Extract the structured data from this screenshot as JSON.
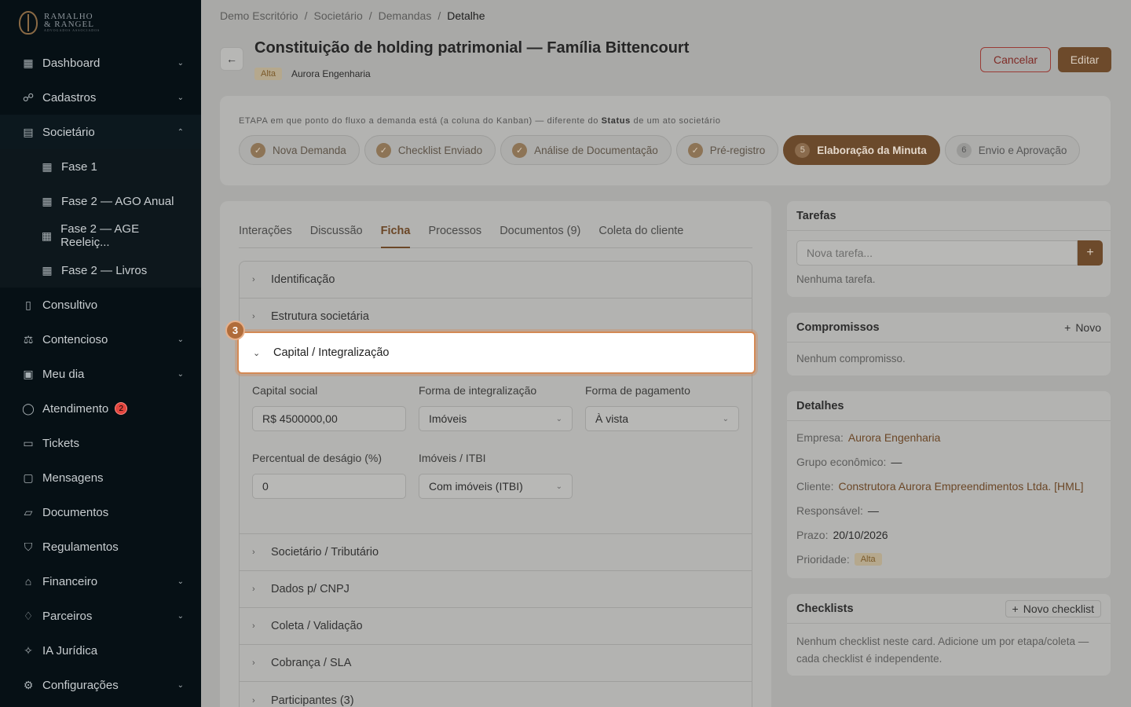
{
  "brand": {
    "line1": "RAMALHO",
    "line2": "& RANGEL",
    "line3": "ADVOGADOS ASSOCIADOS"
  },
  "sidebar": {
    "items": [
      {
        "label": "Dashboard",
        "icon": "grid-icon"
      },
      {
        "label": "Cadastros",
        "icon": "users-icon"
      },
      {
        "label": "Societário",
        "icon": "building-icon"
      },
      {
        "label": "Fase 1",
        "icon": "grid-icon"
      },
      {
        "label": "Fase 2 — AGO Anual",
        "icon": "grid-icon"
      },
      {
        "label": "Fase 2 — AGE Reeleiç...",
        "icon": "grid-icon"
      },
      {
        "label": "Fase 2 — Livros",
        "icon": "grid-icon"
      },
      {
        "label": "Consultivo",
        "icon": "book-icon"
      },
      {
        "label": "Contencioso",
        "icon": "scale-icon"
      },
      {
        "label": "Meu dia",
        "icon": "calendar-icon"
      },
      {
        "label": "Atendimento",
        "icon": "chat-icon",
        "badge": "2"
      },
      {
        "label": "Tickets",
        "icon": "ticket-icon"
      },
      {
        "label": "Mensagens",
        "icon": "message-icon"
      },
      {
        "label": "Documentos",
        "icon": "folder-icon"
      },
      {
        "label": "Regulamentos",
        "icon": "shield-icon"
      },
      {
        "label": "Financeiro",
        "icon": "bank-icon"
      },
      {
        "label": "Parceiros",
        "icon": "handshake-icon"
      },
      {
        "label": "IA Jurídica",
        "icon": "sparkle-icon"
      },
      {
        "label": "Configurações",
        "icon": "gear-icon"
      }
    ]
  },
  "breadcrumb": [
    "Demo Escritório",
    "Societário",
    "Demandas",
    "Detalhe"
  ],
  "header": {
    "title": "Constituição de holding patrimonial — Família Bittencourt",
    "priority": "Alta",
    "company": "Aurora Engenharia",
    "cancel": "Cancelar",
    "edit": "Editar"
  },
  "stages": {
    "label_prefix": "ETAPA",
    "label_text": "em que ponto do fluxo a demanda está (a coluna do Kanban) — diferente do",
    "label_bold": "Status",
    "label_suffix": "de um ato societário",
    "items": [
      {
        "label": "Nova Demanda",
        "state": "done",
        "mark": "✓"
      },
      {
        "label": "Checklist Enviado",
        "state": "done",
        "mark": "✓"
      },
      {
        "label": "Análise de Documentação",
        "state": "done",
        "mark": "✓"
      },
      {
        "label": "Pré-registro",
        "state": "done",
        "mark": "✓"
      },
      {
        "label": "Elaboração da Minuta",
        "state": "current",
        "mark": "5"
      },
      {
        "label": "Envio e Aprovação",
        "state": "todo",
        "mark": "6"
      }
    ]
  },
  "tabs": [
    "Interações",
    "Discussão",
    "Ficha",
    "Processos",
    "Documentos (9)",
    "Coleta do cliente"
  ],
  "active_tab": "Ficha",
  "accordion": {
    "before": [
      "Identificação",
      "Estrutura societária"
    ],
    "open": "Capital / Integralização",
    "after": [
      "Societário / Tributário",
      "Dados p/ CNPJ",
      "Coleta / Validação",
      "Cobrança / SLA",
      "Participantes (3)"
    ]
  },
  "capital": {
    "capital_social_label": "Capital social",
    "capital_social_value": "R$ 4500000,00",
    "forma_integracao_label": "Forma de integralização",
    "forma_integracao_value": "Imóveis",
    "forma_pagamento_label": "Forma de pagamento",
    "forma_pagamento_value": "À vista",
    "desagio_label": "Percentual de deságio (%)",
    "desagio_value": "0",
    "imoveis_label": "Imóveis / ITBI",
    "imoveis_value": "Com imóveis (ITBI)"
  },
  "step_badge": "3",
  "tarefas": {
    "title": "Tarefas",
    "placeholder": "Nova tarefa...",
    "empty": "Nenhuma tarefa."
  },
  "compromissos": {
    "title": "Compromissos",
    "action": "Novo",
    "empty": "Nenhum compromisso."
  },
  "detalhes": {
    "title": "Detalhes",
    "empresa_k": "Empresa:",
    "empresa_v": "Aurora Engenharia",
    "grupo_k": "Grupo econômico:",
    "grupo_v": "—",
    "cliente_k": "Cliente:",
    "cliente_v": "Construtora Aurora Empreendimentos Ltda. [HML]",
    "responsavel_k": "Responsável:",
    "responsavel_v": "—",
    "prazo_k": "Prazo:",
    "prazo_v": "20/10/2026",
    "prioridade_k": "Prioridade:",
    "prioridade_v": "Alta"
  },
  "checklists": {
    "title": "Checklists",
    "action": "Novo checklist",
    "empty": "Nenhum checklist neste card. Adicione um por etapa/coleta — cada checklist é independente."
  }
}
